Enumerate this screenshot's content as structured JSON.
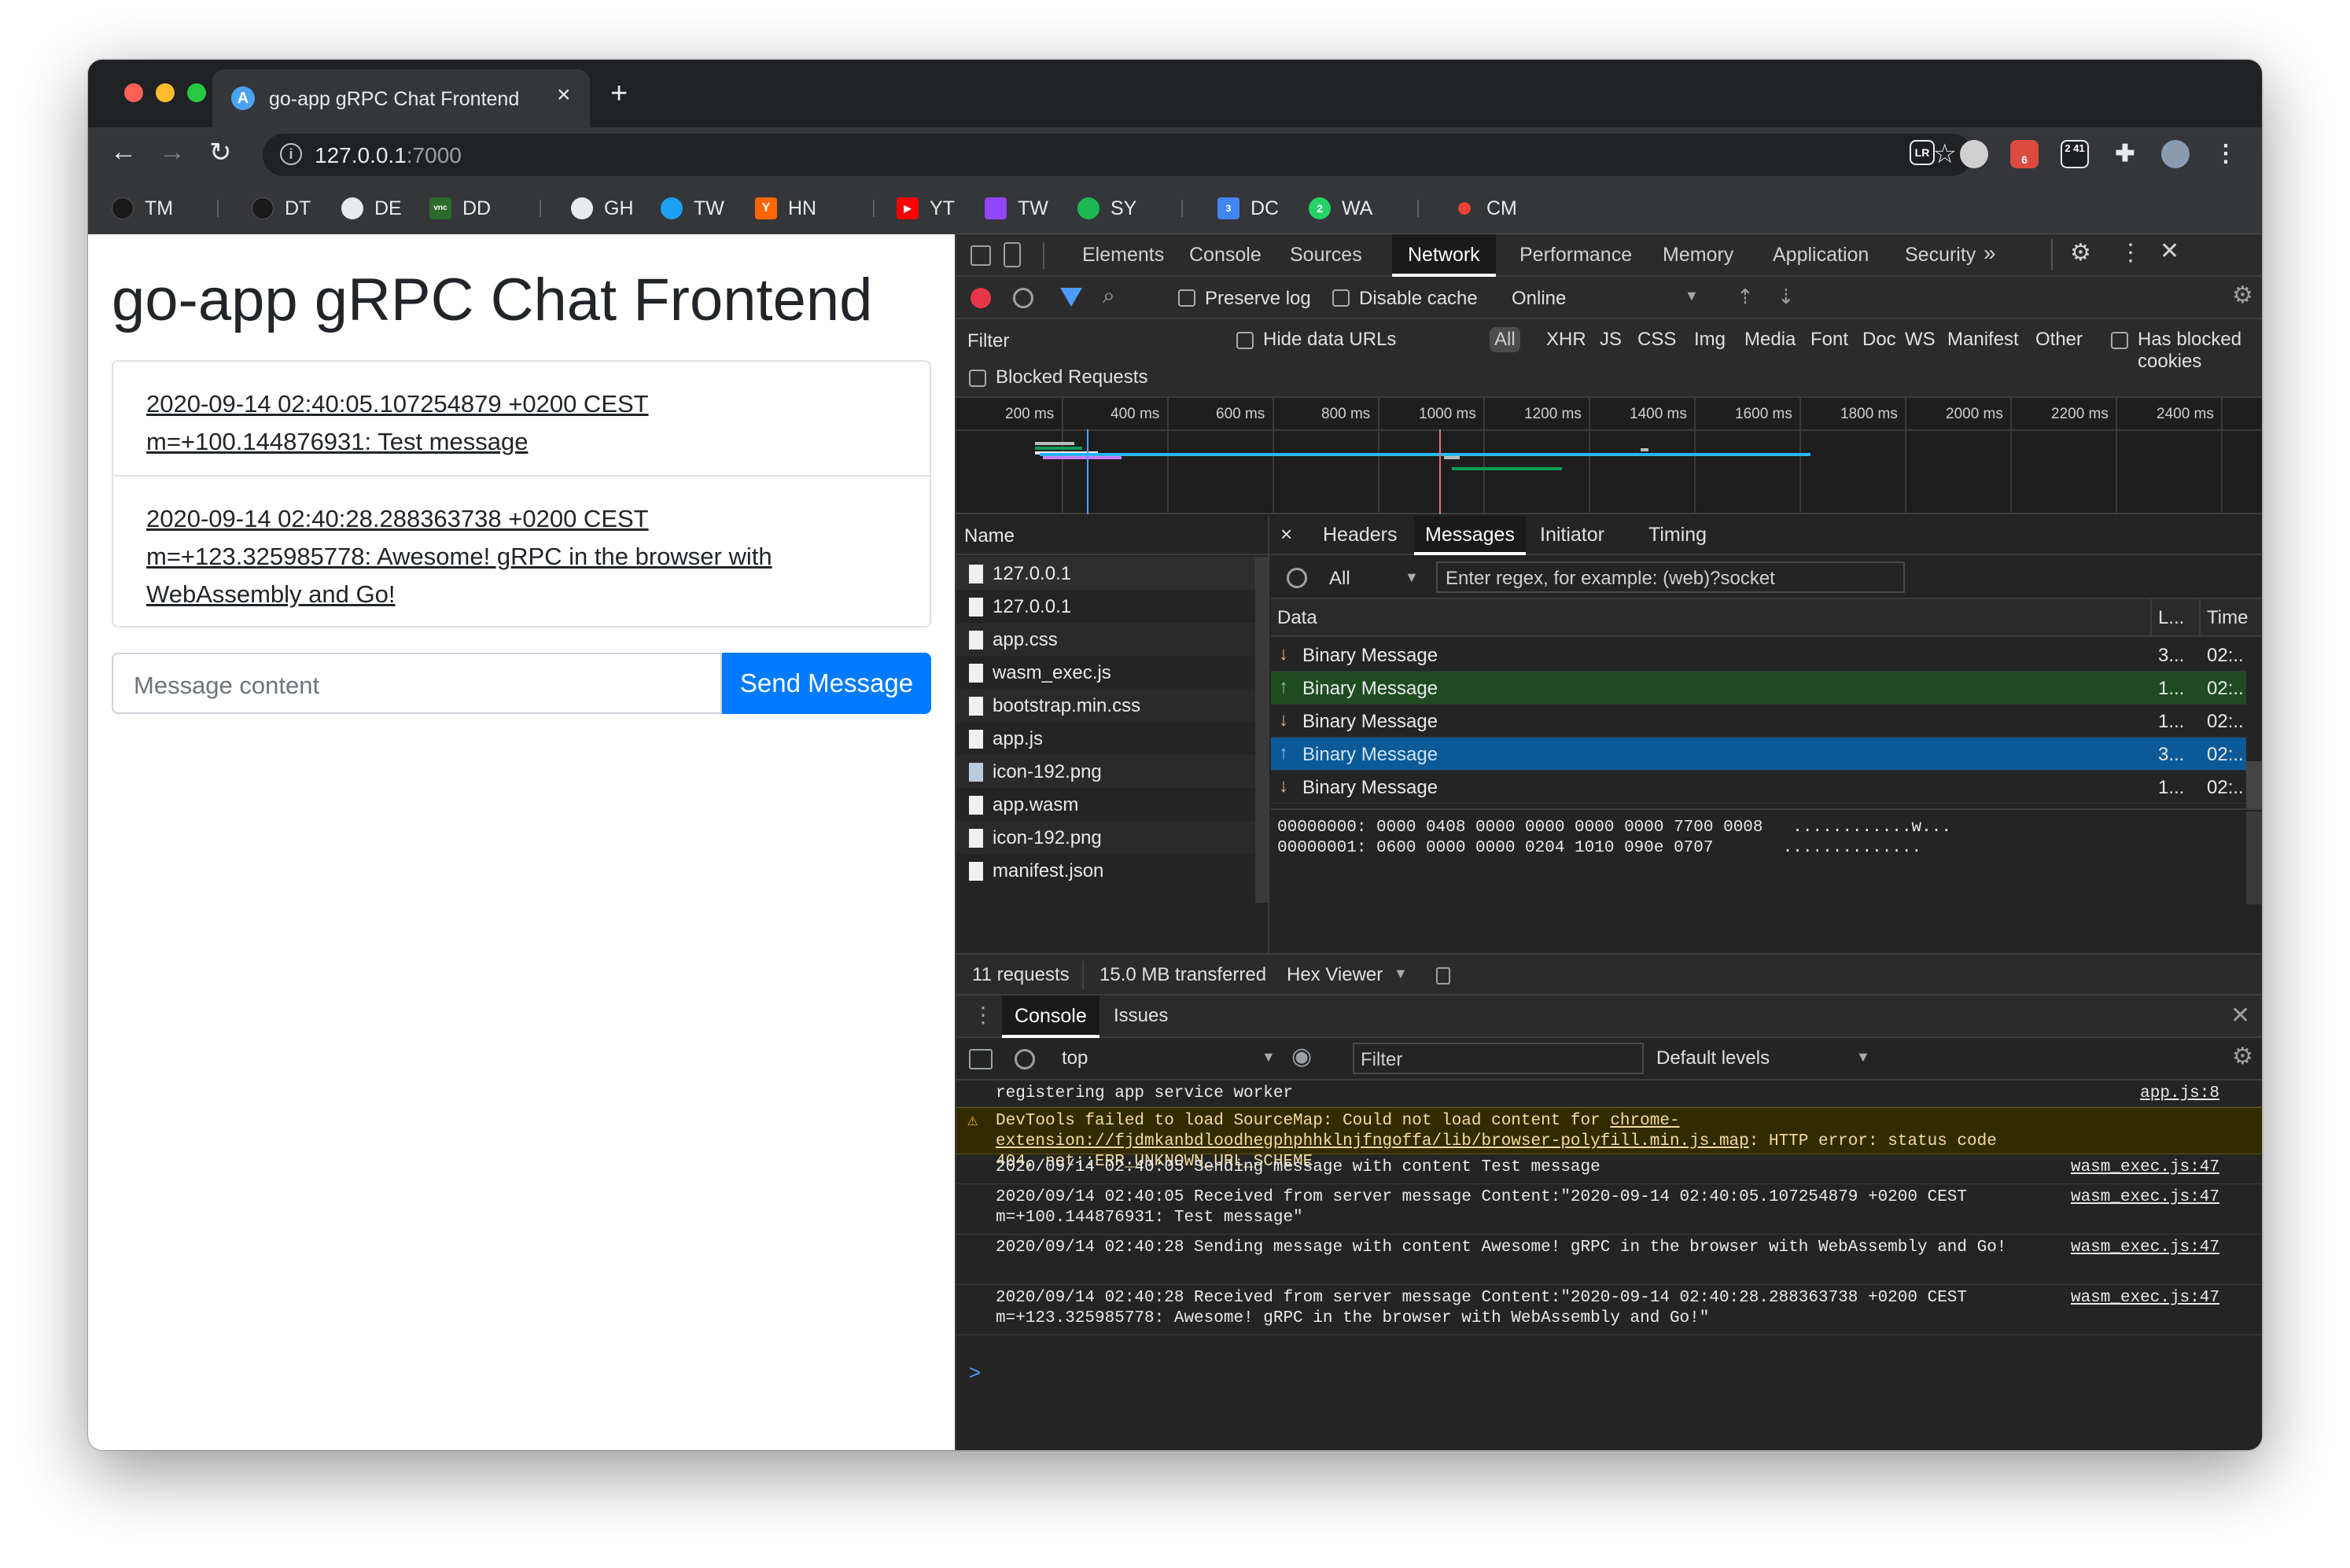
{
  "browser": {
    "tab_title": "go-app gRPC Chat Frontend",
    "tab_close": "×",
    "new_tab": "+",
    "url_host": "127.0.0.1",
    "url_port": ":7000",
    "nav": {
      "back": "←",
      "forward": "→",
      "reload": "↻"
    },
    "extensions": [
      {
        "label": "LR",
        "color": "#1e1f22"
      },
      {
        "label": "",
        "color": "#cccccc"
      },
      {
        "label": "6",
        "color": "#db4c3f"
      },
      {
        "label": "2 41",
        "color": "#1e1f22"
      },
      {
        "label": "",
        "color": "#35363a"
      }
    ],
    "bookmarks": [
      {
        "label": "TM",
        "icon": "tm-icon",
        "color": "#1a1a1a"
      },
      {
        "label": "DT",
        "icon": "dt-icon",
        "color": "#1a1a1a"
      },
      {
        "label": "DE",
        "icon": "globe-icon",
        "color": "#e8eaed"
      },
      {
        "label": "DD",
        "icon": "vnc-icon",
        "color": "#2d6a2d"
      },
      {
        "label": "GH",
        "icon": "github-icon",
        "color": "#e8eaed"
      },
      {
        "label": "TW",
        "icon": "twitter-icon",
        "color": "#1da1f2"
      },
      {
        "label": "HN",
        "icon": "hackernews-icon",
        "color": "#ff6600"
      },
      {
        "label": "YT",
        "icon": "youtube-icon",
        "color": "#ff0000"
      },
      {
        "label": "TW",
        "icon": "twitch-icon",
        "color": "#9146ff"
      },
      {
        "label": "SY",
        "icon": "spotify-icon",
        "color": "#1db954"
      },
      {
        "label": "DC",
        "icon": "calendar-icon",
        "color": "#4285f4"
      },
      {
        "label": "WA",
        "icon": "whatsapp-icon",
        "color": "#25d366"
      },
      {
        "label": "CM",
        "icon": "record-icon",
        "color": "#ea4335"
      }
    ]
  },
  "app": {
    "title": "go-app gRPC Chat Frontend",
    "messages": [
      "2020-09-14 02:40:05.107254879 +0200 CEST m=+100.144876931: Test message",
      "2020-09-14 02:40:28.288363738 +0200 CEST m=+123.325985778: Awesome! gRPC in the browser with WebAssembly and Go!"
    ],
    "input_placeholder": "Message content",
    "send_label": "Send Message"
  },
  "devtools": {
    "tabs": [
      "Elements",
      "Console",
      "Sources",
      "Network",
      "Performance",
      "Memory",
      "Application",
      "Security"
    ],
    "active_tab": "Network",
    "more": "»",
    "toolbar": {
      "preserve_log": "Preserve log",
      "disable_cache": "Disable cache",
      "throttle": "Online"
    },
    "filter": {
      "label": "Filter",
      "hide_data_urls": "Hide data URLs",
      "all": "All",
      "types": [
        "XHR",
        "JS",
        "CSS",
        "Img",
        "Media",
        "Font",
        "Doc",
        "WS",
        "Manifest",
        "Other"
      ],
      "blocked_cookies": "Has blocked cookies",
      "blocked_requests": "Blocked Requests"
    },
    "timeline_ticks": [
      "200 ms",
      "400 ms",
      "600 ms",
      "800 ms",
      "1000 ms",
      "1200 ms",
      "1400 ms",
      "1600 ms",
      "1800 ms",
      "2000 ms",
      "2200 ms",
      "2400 ms"
    ],
    "name_header": "Name",
    "requests": [
      "127.0.0.1",
      "127.0.0.1",
      "app.css",
      "wasm_exec.js",
      "bootstrap.min.css",
      "app.js",
      "icon-192.png",
      "app.wasm",
      "icon-192.png",
      "manifest.json"
    ],
    "detail_tabs": {
      "close": "×",
      "headers": "Headers",
      "messages": "Messages",
      "initiator": "Initiator",
      "timing": "Timing"
    },
    "msg_filter": {
      "dropdown": "All",
      "placeholder": "Enter regex, for example: (web)?socket"
    },
    "msg_columns": {
      "data": "Data",
      "length": "L...",
      "time": "Time"
    },
    "msg_rows": [
      {
        "dir": "down",
        "text": "Binary Message",
        "len": "3...",
        "time": "02:..",
        "style": "normal"
      },
      {
        "dir": "up",
        "text": "Binary Message",
        "len": "1...",
        "time": "02:..",
        "style": "sent"
      },
      {
        "dir": "down",
        "text": "Binary Message",
        "len": "1...",
        "time": "02:..",
        "style": "normal"
      },
      {
        "dir": "up",
        "text": "Binary Message",
        "len": "3...",
        "time": "02:..",
        "style": "selected"
      },
      {
        "dir": "down",
        "text": "Binary Message",
        "len": "1...",
        "time": "02:..",
        "style": "normal"
      }
    ],
    "hex_lines": [
      "00000000: 0000 0408 0000 0000 0000 0000 7700 0008   ............w...",
      "00000001: 0600 0000 0000 0204 1010 090e 0707       .............."
    ],
    "status": {
      "requests": "11 requests",
      "transferred": "15.0 MB transferred",
      "hex_viewer": "Hex Viewer"
    },
    "drawer_tabs": {
      "console": "Console",
      "issues": "Issues"
    },
    "console_toolbar": {
      "context": "top",
      "filter_placeholder": "Filter",
      "levels": "Default levels"
    },
    "console_logs": [
      {
        "text": "registering app service worker",
        "src": "app.js:8",
        "type": "log"
      },
      {
        "text": "DevTools failed to load SourceMap: Could not load content for ",
        "link": "chrome-extension://fjdmkanbdloodhegphphhklnjfngoffa/lib/browser-polyfill.min.js.map",
        "tail": ": HTTP error: status code 404, net::ERR_UNKNOWN_URL_SCHEME",
        "src": "",
        "type": "warn"
      },
      {
        "text": "2020/09/14 02:40:05 Sending message with content Test message",
        "src": "wasm_exec.js:47",
        "type": "log"
      },
      {
        "text": "2020/09/14 02:40:05 Received from server message Content:\"2020-09-14 02:40:05.107254879 +0200 CEST m=+100.144876931: Test message\"",
        "src": "wasm_exec.js:47",
        "type": "log"
      },
      {
        "text": "2020/09/14 02:40:28 Sending message with content Awesome! gRPC in the browser with WebAssembly and Go!",
        "src": "wasm_exec.js:47",
        "type": "log"
      },
      {
        "text": "2020/09/14 02:40:28 Received from server message Content:\"2020-09-14 02:40:28.288363738 +0200 CEST m=+123.325985778: Awesome! gRPC in the browser with WebAssembly and Go!\"",
        "src": "wasm_exec.js:47",
        "type": "log"
      }
    ],
    "prompt": ">"
  }
}
